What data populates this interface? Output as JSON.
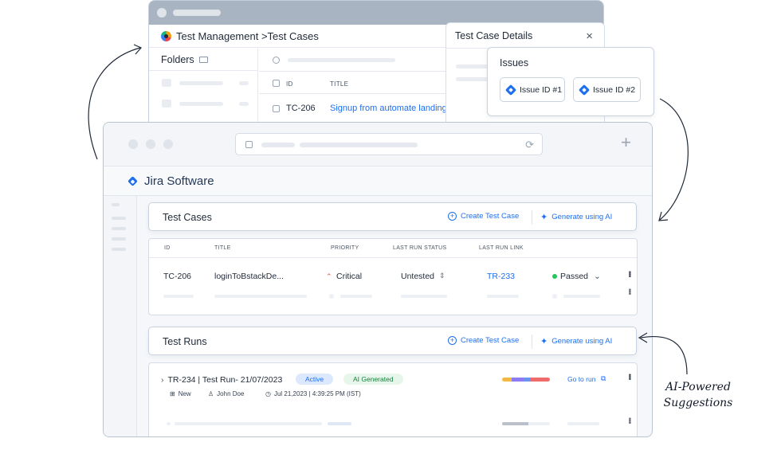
{
  "back_window": {
    "title": "Test Management >Test Cases",
    "folders_label": "Folders",
    "table": {
      "col_id": "ID",
      "col_title": "TITLE",
      "row": {
        "id": "TC-206",
        "title": "Signup from automate landing"
      }
    }
  },
  "details_panel": {
    "title": "Test Case Details",
    "close_glyph": "×"
  },
  "issues": {
    "title": "Issues",
    "items": [
      {
        "label": "Issue ID #1"
      },
      {
        "label": "Issue ID #2"
      }
    ]
  },
  "browser": {
    "reload_glyph": "⟳",
    "new_tab_glyph": "+"
  },
  "app": {
    "brand": "Jira Software"
  },
  "test_cases": {
    "title": "Test Cases",
    "create_label": "Create Test Case",
    "generate_label": "Generate using AI",
    "columns": [
      "ID",
      "TITLE",
      "PRIORITY",
      "LAST RUN STATUS",
      "LAST RUN LINK"
    ],
    "row": {
      "id": "TC-206",
      "title": "loginToBstackDe...",
      "priority": "Critical",
      "priority_glyph": "⌃",
      "last_run_status": "Untested",
      "status_glyph": "⇕",
      "last_run_link": "TR-233",
      "result": "Passed",
      "result_glyph": "⌄"
    }
  },
  "test_runs": {
    "title": "Test Runs",
    "create_label": "Create Test Case",
    "generate_label": "Generate using AI",
    "run": {
      "expand_glyph": "›",
      "title": "TR-234 | Test Run- 21/07/2023",
      "badge_active": "Active",
      "badge_ai": "AI Generated",
      "state": "New",
      "assignee": "John Doe",
      "datetime": "Jul 21,2023 | 4:39:25 PM (IST)",
      "go_to_run": "Go to run",
      "progress_segments": [
        {
          "color": "#f5b942",
          "fraction": 0.2
        },
        {
          "color": "#8b7cf6",
          "fraction": 0.25
        },
        {
          "color": "#6b93f0",
          "fraction": 0.15
        },
        {
          "color": "#ef6b6b",
          "fraction": 0.4
        }
      ]
    }
  },
  "annotation": {
    "line1": "AI-Powered",
    "line2": "Suggestions"
  },
  "colors": {
    "accent": "#1d6ff0",
    "passed": "#22c55e",
    "critical": "#e5533d",
    "badge_active_bg": "#dbe8fd",
    "badge_ai_bg": "#e6f6ea"
  }
}
